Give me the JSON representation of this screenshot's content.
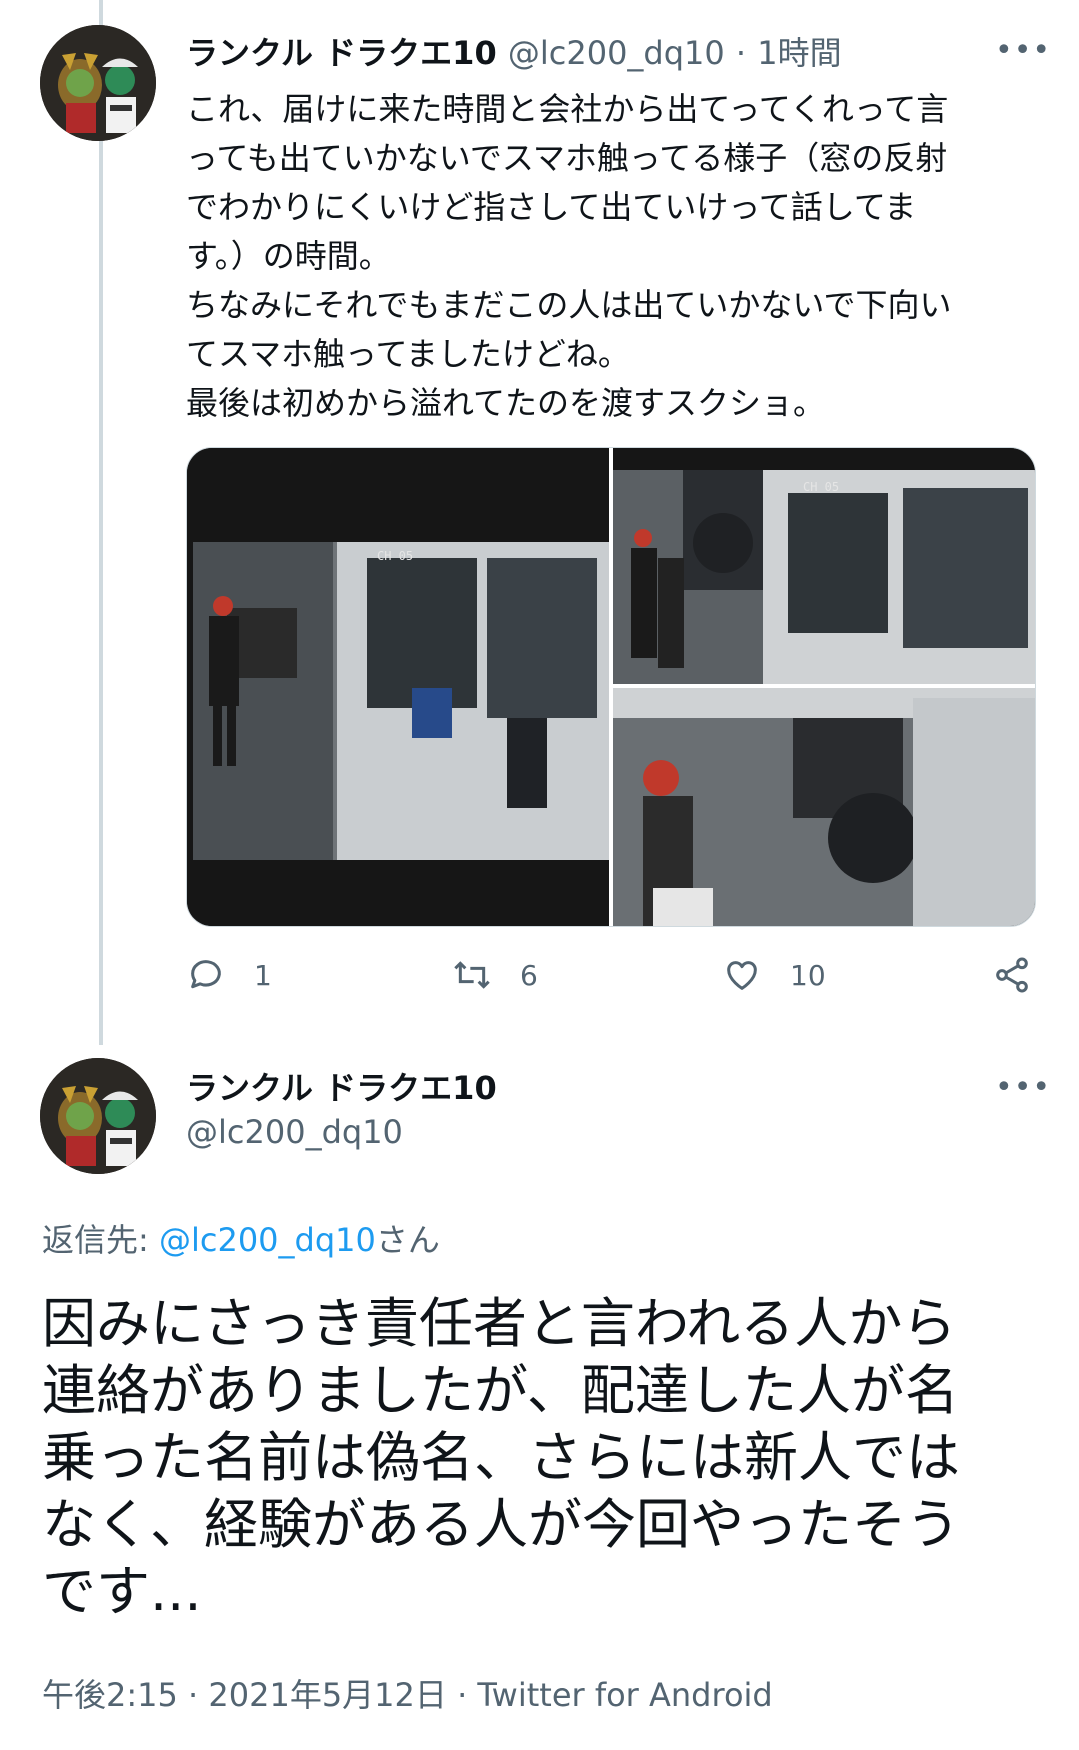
{
  "tweet1": {
    "display_name": "ランクル ドラクエ10",
    "handle": "@lc200_dq10",
    "separator": "·",
    "time": "1時間",
    "more": "•••",
    "text_lines": [
      "これ、届けに来た時間と会社から出てってくれって言",
      "っても出ていかないでスマホ触ってる様子（窓の反射",
      "でわかりにくいけど指さして出ていけって話してま",
      "す。）の時間。",
      "ちなみにそれでもまだこの人は出ていかないで下向い",
      "てスマホ触ってましたけどね。",
      "最後は初めから溢れてたのを渡すスクショ。"
    ],
    "media": [
      {
        "overlay": "CH 05"
      },
      {
        "overlay": "CH 05"
      },
      {
        "overlay": ""
      }
    ],
    "actions": {
      "reply_count": "1",
      "retweet_count": "6",
      "like_count": "10"
    }
  },
  "tweet2": {
    "display_name": "ランクル ドラクエ10",
    "handle": "@lc200_dq10",
    "more": "•••",
    "reply_prefix": "返信先: ",
    "reply_handle": "@lc200_dq10",
    "reply_suffix": "さん",
    "text_lines": [
      "因みにさっき責任者と言われる人から",
      "連絡がありましたが、配達した人が名",
      "乗った名前は偽名、さらには新人では",
      "なく、経験がある人が今回やったそう",
      "です..."
    ],
    "meta": "午後2:15 · 2021年5月12日 · Twitter for Android"
  },
  "colors": {
    "text": "#0f1419",
    "secondary": "#536471",
    "link": "#1d9bf0",
    "thread_line": "#cfd9de"
  },
  "icons": [
    "avatar",
    "more-icon",
    "reply-icon",
    "retweet-icon",
    "like-icon",
    "share-icon"
  ]
}
